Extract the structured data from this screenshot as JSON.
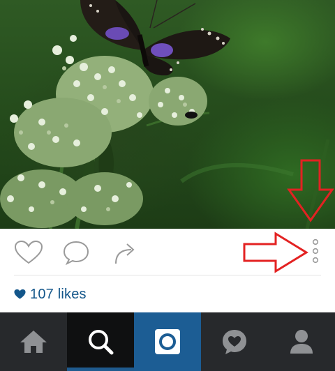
{
  "post": {
    "image_subject": "butterfly-on-flower-photo",
    "likes_text": "107 likes"
  },
  "actions": {
    "like_icon": "heart-outline-icon",
    "comment_icon": "speech-bubble-icon",
    "share_icon": "share-arrow-icon",
    "more_icon": "vertical-ellipsis-icon"
  },
  "bottom_nav": {
    "tabs": [
      {
        "id": "home",
        "icon": "home-icon"
      },
      {
        "id": "search",
        "icon": "search-icon",
        "selected": true
      },
      {
        "id": "camera",
        "icon": "camera-icon"
      },
      {
        "id": "activity",
        "icon": "heart-bubble-icon"
      },
      {
        "id": "profile",
        "icon": "person-icon"
      }
    ]
  },
  "colors": {
    "likes_blue": "#13568a",
    "nav_bg": "#27292c",
    "camera_tab": "#1c5d94",
    "annotation_red": "#e32222"
  }
}
